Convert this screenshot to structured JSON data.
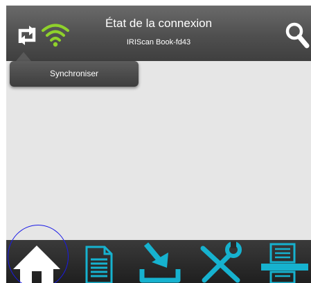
{
  "header": {
    "title": "État de la connexion",
    "subtitle": "IRIScan Book-fd43",
    "icons": {
      "sync": "sync-icon",
      "wifi": "wifi-icon",
      "search": "search-icon"
    },
    "wifi_color": "#8fd12b"
  },
  "tooltip": {
    "label": "Synchroniser"
  },
  "bottom_nav": {
    "items": [
      {
        "icon": "home-icon",
        "selected": true
      },
      {
        "icon": "document-icon"
      },
      {
        "icon": "download-icon"
      },
      {
        "icon": "settings-tools-icon"
      },
      {
        "icon": "scanner-icon"
      }
    ],
    "accent_color": "#16b2cf"
  }
}
